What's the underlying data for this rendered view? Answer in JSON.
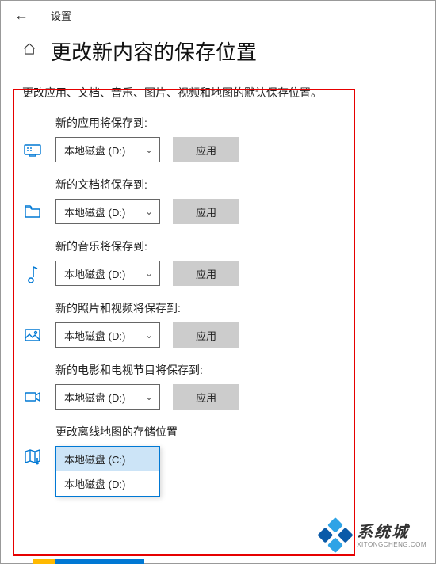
{
  "header": {
    "settings_label": "设置"
  },
  "page_title": "更改新内容的保存位置",
  "intro": "更改应用、文档、音乐、图片、视频和地图的默认保存位置。",
  "apply_label": "应用",
  "sections": {
    "apps": {
      "label": "新的应用将保存到:",
      "value": "本地磁盘 (D:)"
    },
    "docs": {
      "label": "新的文档将保存到:",
      "value": "本地磁盘 (D:)"
    },
    "music": {
      "label": "新的音乐将保存到:",
      "value": "本地磁盘 (D:)"
    },
    "photos": {
      "label": "新的照片和视频将保存到:",
      "value": "本地磁盘 (D:)"
    },
    "movies": {
      "label": "新的电影和电视节目将保存到:",
      "value": "本地磁盘 (D:)"
    },
    "maps": {
      "label": "更改离线地图的存储位置"
    }
  },
  "maps_dropdown": {
    "option_c": "本地磁盘 (C:)",
    "option_d": "本地磁盘 (D:)"
  },
  "watermark": {
    "cn": "系统城",
    "en": "XITONGCHENG.COM"
  },
  "colors": {
    "accent": "#0078d4",
    "highlight": "#e60000",
    "logo1": "#2ea3e6",
    "logo2": "#0a5aa8"
  }
}
